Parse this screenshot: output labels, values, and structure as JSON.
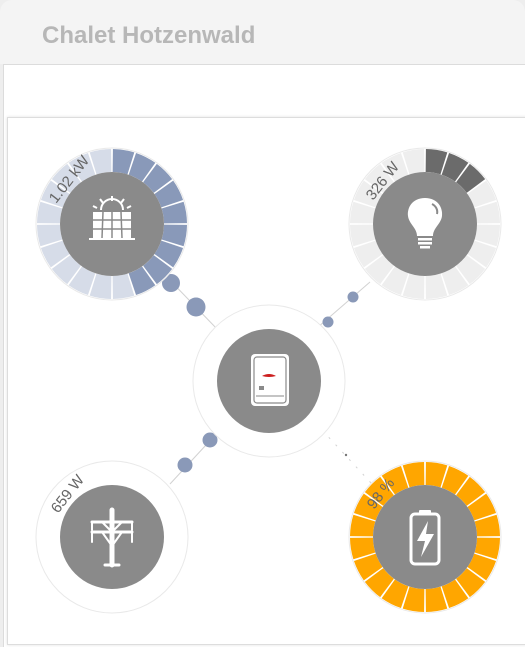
{
  "header": {
    "title": "Chalet Hotzenwald"
  },
  "flow": {
    "solar": {
      "label": "1.02 kW",
      "level": 0.43,
      "icon": "solar-panel-icon",
      "color": "#8999b9",
      "track": "#d6dce8"
    },
    "consumer": {
      "label": "326 W",
      "level": 0.13,
      "icon": "light-bulb-icon",
      "color": "#6b6b6b",
      "track": "#eeeeee"
    },
    "grid": {
      "label": "659 W",
      "icon": "power-pylon-icon"
    },
    "battery": {
      "label": "98 %",
      "level": 0.98,
      "icon": "battery-charging-icon",
      "color": "#ffa600",
      "track": "#fbeccf"
    },
    "inverter": {
      "icon": "inverter-icon"
    },
    "colors": {
      "disc": "#8a8a8a",
      "dot": "#8a99b8",
      "ring": "#e7e7e7"
    }
  }
}
